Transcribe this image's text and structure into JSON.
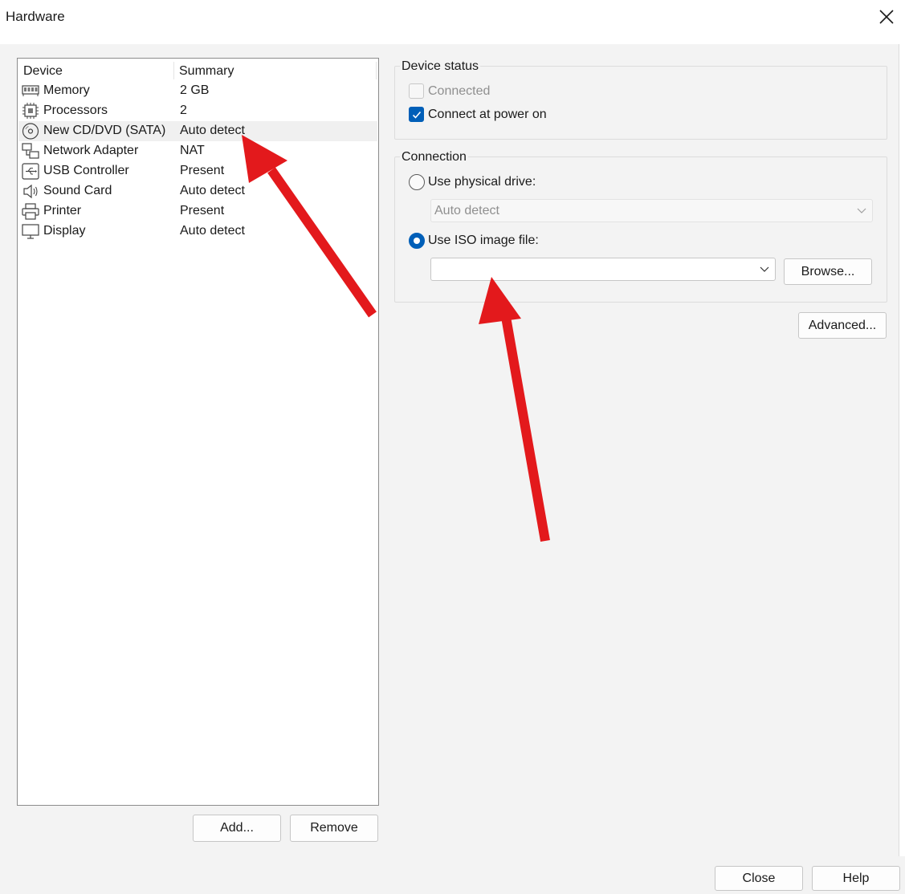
{
  "window": {
    "title": "Hardware"
  },
  "device_list": {
    "columns": [
      "Device",
      "Summary"
    ],
    "rows": [
      {
        "name": "Memory",
        "summary": "2 GB",
        "icon": "memory-icon"
      },
      {
        "name": "Processors",
        "summary": "2",
        "icon": "processor-icon"
      },
      {
        "name": "New CD/DVD (SATA)",
        "summary": "Auto detect",
        "icon": "cd-dvd-icon",
        "selected": true
      },
      {
        "name": "Network Adapter",
        "summary": "NAT",
        "icon": "network-adapter-icon"
      },
      {
        "name": "USB Controller",
        "summary": "Present",
        "icon": "usb-icon"
      },
      {
        "name": "Sound Card",
        "summary": "Auto detect",
        "icon": "speaker-icon"
      },
      {
        "name": "Printer",
        "summary": "Present",
        "icon": "printer-icon"
      },
      {
        "name": "Display",
        "summary": "Auto detect",
        "icon": "monitor-icon"
      }
    ]
  },
  "device_status": {
    "label": "Device status",
    "connected": {
      "label": "Connected",
      "checked": false,
      "enabled": false
    },
    "connect_at_power_on": {
      "label": "Connect at power on",
      "checked": true
    }
  },
  "connection": {
    "label": "Connection",
    "use_physical_drive": {
      "label": "Use physical drive:",
      "selected": false
    },
    "physical_drive_value": "Auto detect",
    "use_iso_image": {
      "label": "Use ISO image file:",
      "selected": true
    },
    "iso_path_value": "",
    "browse_label": "Browse..."
  },
  "buttons": {
    "advanced": "Advanced...",
    "add": "Add...",
    "remove": "Remove",
    "close": "Close",
    "help": "Help"
  },
  "colors": {
    "accent": "#005fb8",
    "annotation_arrow": "#e3191c"
  }
}
